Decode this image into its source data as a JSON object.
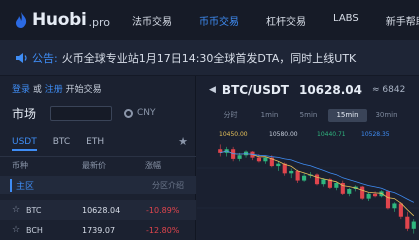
{
  "brand": {
    "name": "Huobi",
    "suffix": ".pro"
  },
  "nav": [
    "法币交易",
    "币币交易",
    "杠杆交易",
    "LABS",
    "新手帮助"
  ],
  "announcement": {
    "label": "公告:",
    "text": "火币全球专业站1月17日14:30全球首发DTA，同时上线UTK"
  },
  "left": {
    "login": {
      "login": "登录",
      "or": " 或 ",
      "register": "注册",
      "start": " 开始交易"
    },
    "market_title": "市场",
    "currency": "CNY",
    "tabs": [
      "USDT",
      "BTC",
      "ETH"
    ],
    "columns": [
      "币种",
      "最新价",
      "涨幅"
    ],
    "board": {
      "name": "主区",
      "link": "分区介绍"
    },
    "coins": [
      {
        "name": "BTC",
        "price": "10628.04",
        "change": "-10.89%"
      },
      {
        "name": "BCH",
        "price": "1739.07",
        "change": "-12.80%"
      }
    ]
  },
  "chart_panel": {
    "pair": "BTC/USDT",
    "price": "10628.04",
    "cny": "≈ 6842",
    "intervals": [
      "分时",
      "1min",
      "5min",
      "15min",
      "30min"
    ],
    "active_interval": "15min",
    "ma_values": [
      "10450.00",
      "10580.00",
      "10440.71",
      "10528.35"
    ]
  },
  "colors": {
    "up": "#2fb67f",
    "down": "#e0454d",
    "accent": "#3f8df5"
  },
  "chart_data": {
    "type": "candlestick",
    "candles": [
      {
        "o": 10590,
        "h": 10610,
        "l": 10560,
        "c": 10575
      },
      {
        "o": 10575,
        "h": 10600,
        "l": 10560,
        "c": 10590
      },
      {
        "o": 10590,
        "h": 10600,
        "l": 10540,
        "c": 10550
      },
      {
        "o": 10550,
        "h": 10575,
        "l": 10540,
        "c": 10565
      },
      {
        "o": 10565,
        "h": 10585,
        "l": 10555,
        "c": 10580
      },
      {
        "o": 10580,
        "h": 10582,
        "l": 10545,
        "c": 10555
      },
      {
        "o": 10555,
        "h": 10570,
        "l": 10535,
        "c": 10540
      },
      {
        "o": 10540,
        "h": 10560,
        "l": 10530,
        "c": 10555
      },
      {
        "o": 10555,
        "h": 10565,
        "l": 10515,
        "c": 10520
      },
      {
        "o": 10520,
        "h": 10540,
        "l": 10500,
        "c": 10530
      },
      {
        "o": 10530,
        "h": 10535,
        "l": 10480,
        "c": 10490
      },
      {
        "o": 10490,
        "h": 10510,
        "l": 10470,
        "c": 10500
      },
      {
        "o": 10500,
        "h": 10505,
        "l": 10450,
        "c": 10460
      },
      {
        "o": 10460,
        "h": 10490,
        "l": 10455,
        "c": 10480
      },
      {
        "o": 10480,
        "h": 10495,
        "l": 10470,
        "c": 10485
      },
      {
        "o": 10485,
        "h": 10490,
        "l": 10440,
        "c": 10445
      },
      {
        "o": 10445,
        "h": 10470,
        "l": 10435,
        "c": 10465
      },
      {
        "o": 10465,
        "h": 10470,
        "l": 10425,
        "c": 10430
      },
      {
        "o": 10430,
        "h": 10455,
        "l": 10420,
        "c": 10450
      },
      {
        "o": 10450,
        "h": 10460,
        "l": 10400,
        "c": 10405
      },
      {
        "o": 10405,
        "h": 10430,
        "l": 10395,
        "c": 10425
      },
      {
        "o": 10425,
        "h": 10440,
        "l": 10415,
        "c": 10435
      },
      {
        "o": 10435,
        "h": 10438,
        "l": 10380,
        "c": 10385
      },
      {
        "o": 10385,
        "h": 10410,
        "l": 10375,
        "c": 10405
      },
      {
        "o": 10405,
        "h": 10415,
        "l": 10390,
        "c": 10395
      },
      {
        "o": 10395,
        "h": 10420,
        "l": 10390,
        "c": 10415
      },
      {
        "o": 10415,
        "h": 10420,
        "l": 10340,
        "c": 10345
      },
      {
        "o": 10345,
        "h": 10370,
        "l": 10330,
        "c": 10365
      },
      {
        "o": 10365,
        "h": 10370,
        "l": 10300,
        "c": 10310
      },
      {
        "o": 10310,
        "h": 10330,
        "l": 10250,
        "c": 10260
      },
      {
        "o": 10260,
        "h": 10300,
        "l": 10240,
        "c": 10290
      }
    ],
    "ylim": [
      10230,
      10620
    ]
  }
}
